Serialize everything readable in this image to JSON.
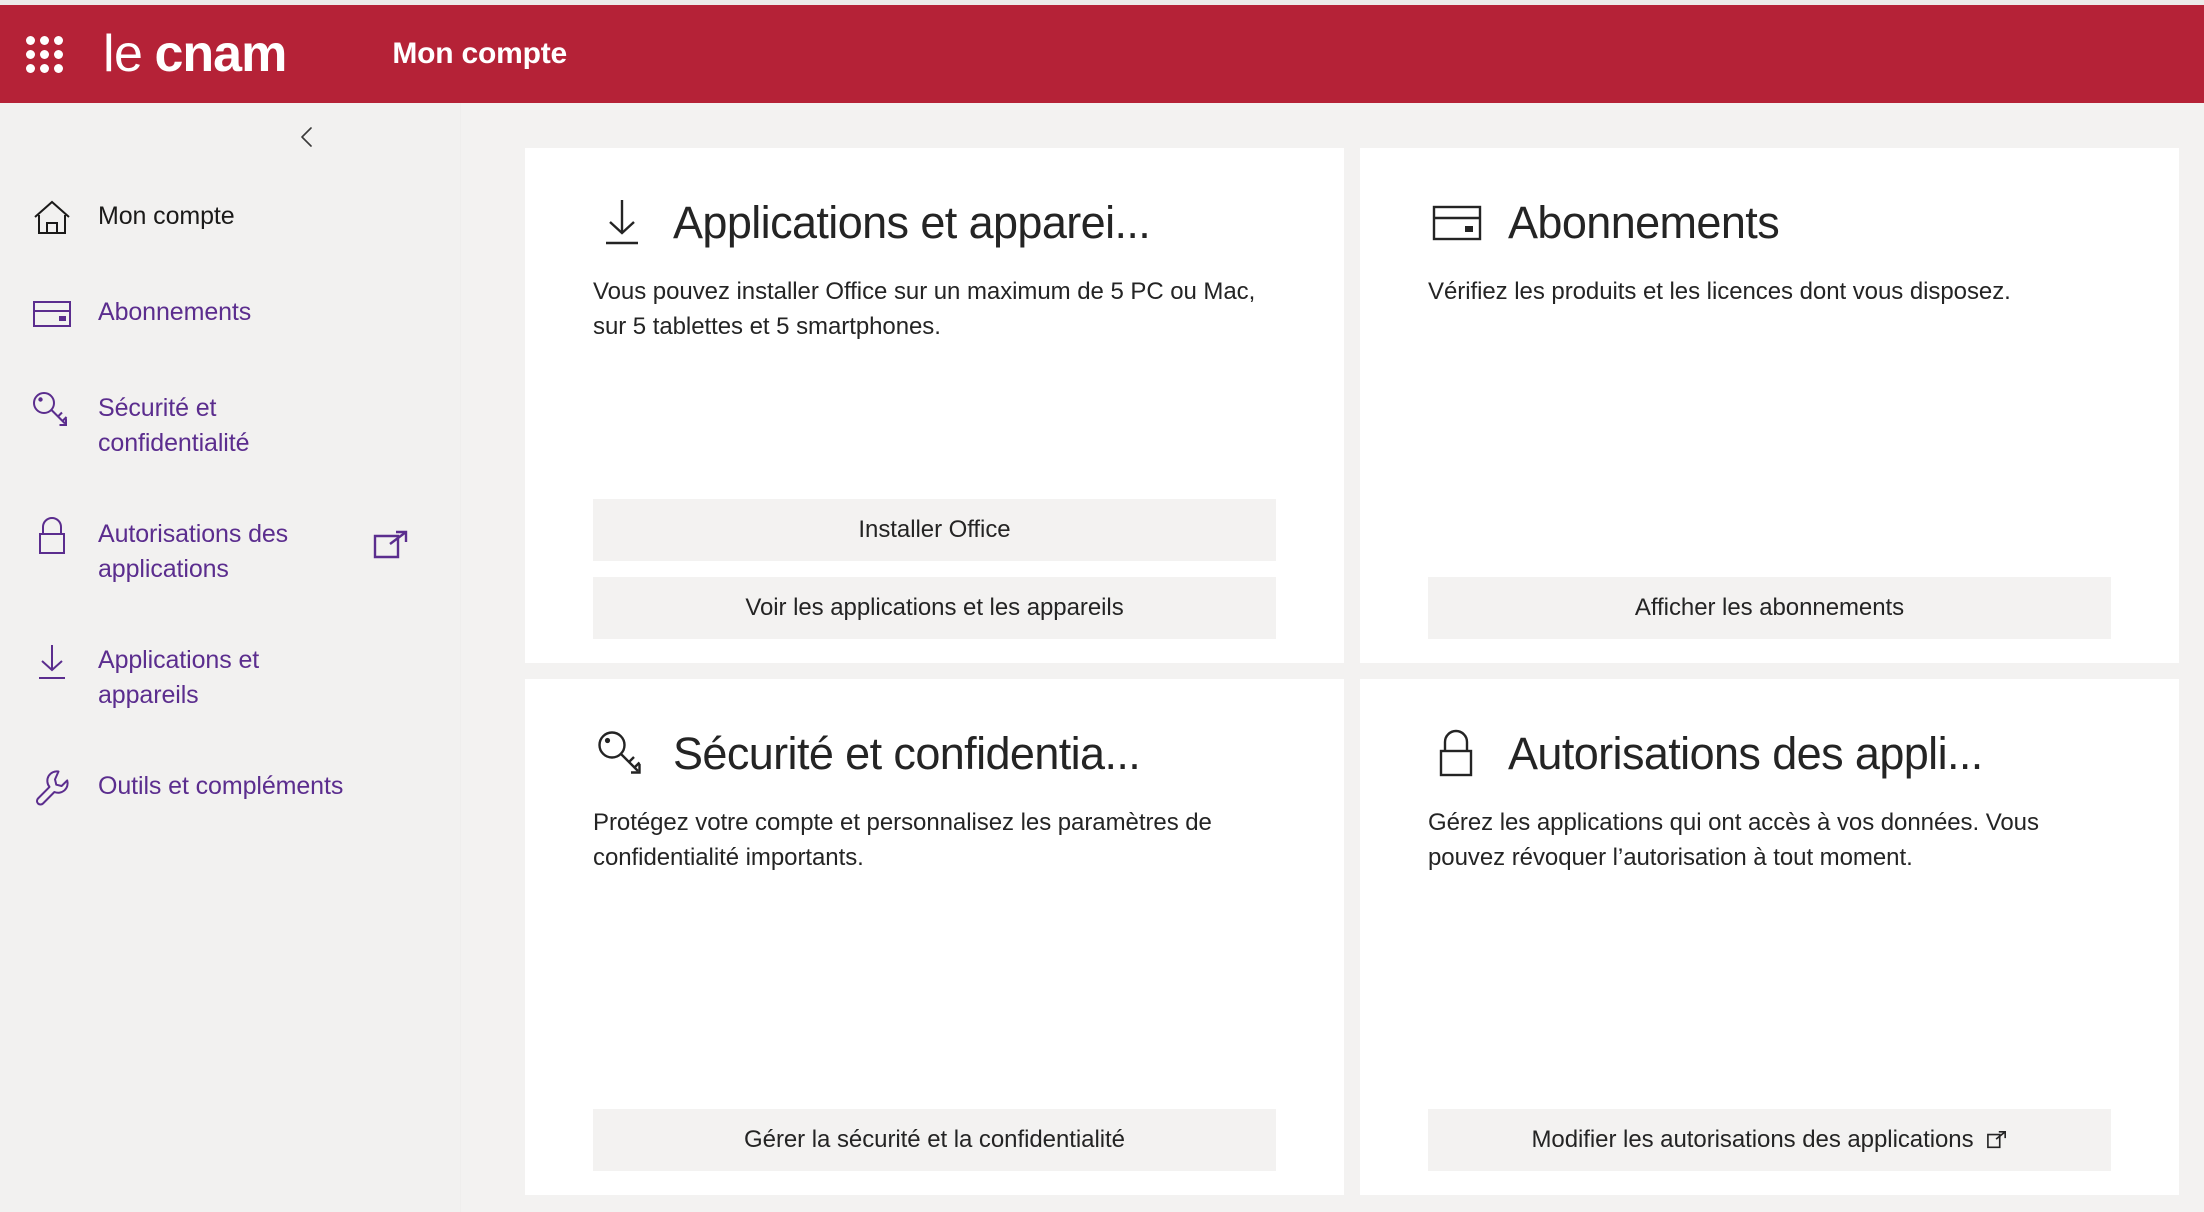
{
  "theme": {
    "brand_red": "#b52237",
    "link_purple": "#5b2d8e",
    "page_bg": "#f3f2f1",
    "sidebar_bg": "#f2f1f0",
    "card_bg": "#ffffff",
    "button_bg": "#f3f2f1",
    "text_dark": "#242424"
  },
  "header": {
    "waffle_icon": "app-launcher-waffle-icon",
    "brand_first": "le",
    "brand_second": "cnam",
    "title": "Mon compte"
  },
  "sidebar": {
    "collapse_icon": "chevron-left-icon",
    "items": [
      {
        "label": "Mon compte",
        "icon": "home-icon",
        "active": true,
        "external": false
      },
      {
        "label": "Abonnements",
        "icon": "credit-card-icon",
        "active": false,
        "external": false
      },
      {
        "label": "Sécurité et confidentialité",
        "icon": "key-icon",
        "active": false,
        "external": false
      },
      {
        "label": "Autorisations des applications",
        "icon": "lock-icon",
        "active": false,
        "external": true,
        "external_icon": "external-link-icon"
      },
      {
        "label": "Applications et appareils",
        "icon": "download-arrow-icon",
        "active": false,
        "external": false
      },
      {
        "label": "Outils et compléments",
        "icon": "wrench-icon",
        "active": false,
        "external": false
      }
    ]
  },
  "main": {
    "cards": [
      {
        "icon": "download-arrow-icon",
        "title": "Applications et apparei...",
        "description": "Vous pouvez installer Office sur un maximum de 5 PC ou Mac, sur 5 tablettes et 5 smartphones.",
        "buttons": [
          {
            "label": "Installer Office",
            "external": false
          },
          {
            "label": "Voir les applications et les appareils",
            "external": false
          }
        ]
      },
      {
        "icon": "credit-card-icon",
        "title": "Abonnements",
        "description": "Vérifiez les produits et les licences dont vous disposez.",
        "buttons": [
          {
            "label": "Afficher les abonnements",
            "external": false
          }
        ]
      },
      {
        "icon": "key-icon",
        "title": "Sécurité et confidentia...",
        "description": "Protégez votre compte et personnalisez les paramètres de confidentialité importants.",
        "buttons": [
          {
            "label": "Gérer la sécurité et la confidentialité",
            "external": false
          }
        ]
      },
      {
        "icon": "lock-icon",
        "title": "Autorisations des appli...",
        "description": "Gérez les applications qui ont accès à vos données. Vous pouvez révoquer l’autorisation à tout moment.",
        "buttons": [
          {
            "label": "Modifier les autorisations des applications",
            "external": true,
            "external_icon": "external-link-icon"
          }
        ]
      }
    ]
  }
}
